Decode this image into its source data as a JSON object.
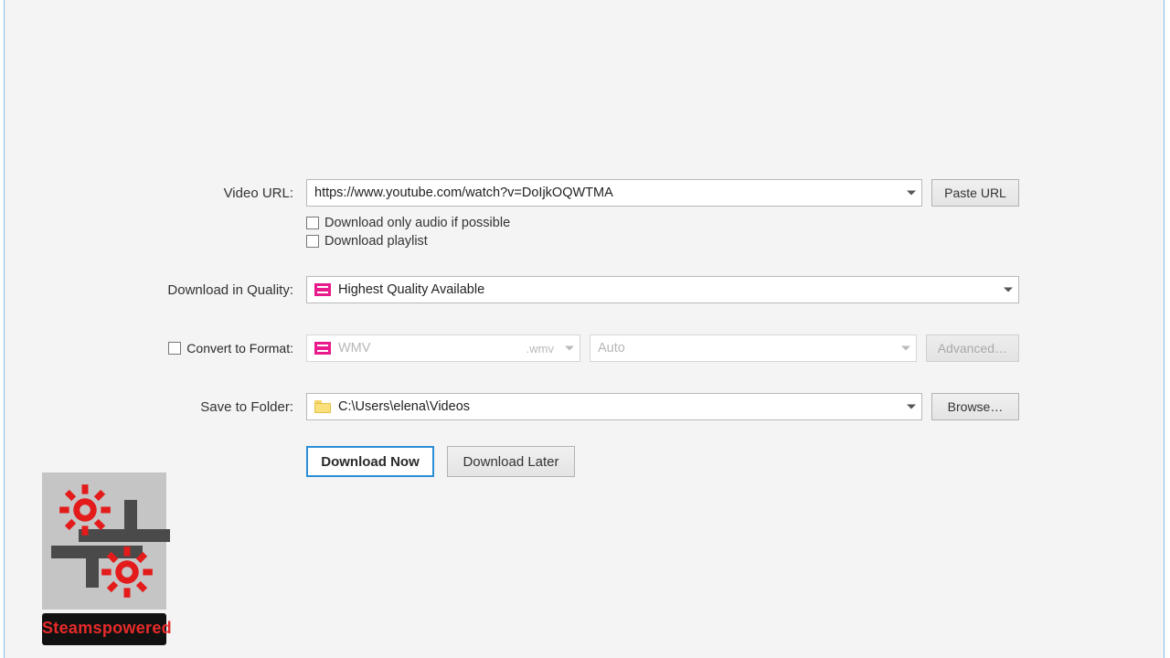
{
  "labels": {
    "video_url": "Video URL:",
    "quality": "Download in Quality:",
    "convert": "Convert to Format:",
    "save": "Save to Folder:"
  },
  "url_field": {
    "value": "https://www.youtube.com/watch?v=DoIjkOQWTMA"
  },
  "buttons": {
    "paste": "Paste URL",
    "advanced": "Advanced…",
    "browse": "Browse…",
    "download_now": "Download Now",
    "download_later": "Download Later"
  },
  "checks": {
    "audio_only": "Download only audio if possible",
    "playlist": "Download playlist"
  },
  "quality_combo": {
    "value": "Highest Quality Available"
  },
  "format_combo": {
    "value": "WMV",
    "ext": ".wmv"
  },
  "preset_combo": {
    "value": "Auto"
  },
  "folder_combo": {
    "value": "C:\\Users\\elena\\Videos"
  },
  "watermark": {
    "brand": "Steamspowered"
  }
}
